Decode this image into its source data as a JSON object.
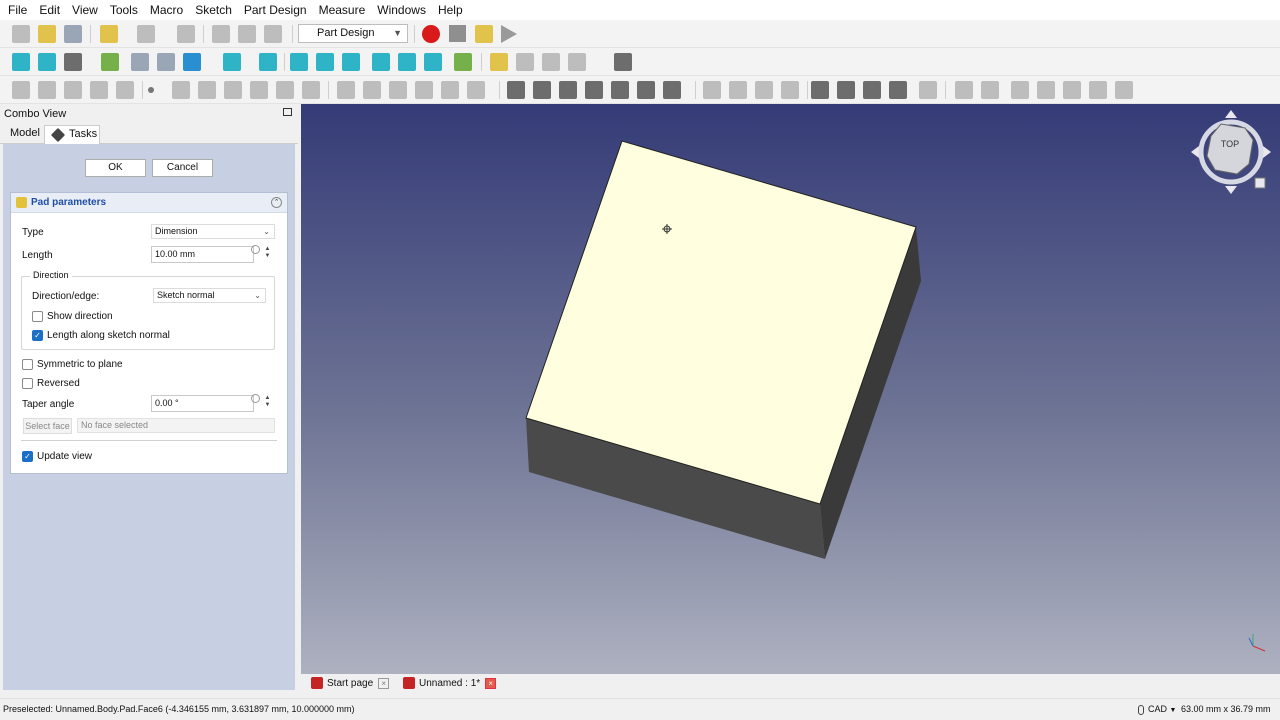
{
  "menu": [
    "File",
    "Edit",
    "View",
    "Tools",
    "Macro",
    "Sketch",
    "Part Design",
    "Measure",
    "Windows",
    "Help"
  ],
  "toolbar": {
    "workbench": "Part Design"
  },
  "combo_view": {
    "title": "Combo View",
    "tabs": [
      "Model",
      "Tasks"
    ],
    "ok_label": "OK",
    "cancel_label": "Cancel",
    "pad": {
      "title": "Pad parameters",
      "type_label": "Type",
      "type_value": "Dimension",
      "length_label": "Length",
      "length_value": "10.00 mm",
      "direction_group": "Direction",
      "direction_label": "Direction/edge:",
      "direction_value": "Sketch normal",
      "show_direction": "Show direction",
      "show_direction_checked": false,
      "length_along_normal": "Length along sketch normal",
      "length_along_normal_checked": true,
      "symmetric": "Symmetric to plane",
      "symmetric_checked": false,
      "reversed": "Reversed",
      "reversed_checked": false,
      "taper_label": "Taper angle",
      "taper_value": "0.00 °",
      "select_face": "Select face",
      "no_face": "No face selected",
      "update_view": "Update view",
      "update_view_checked": true
    }
  },
  "viewport": {
    "navcube_label": "TOP",
    "colors": {
      "top_face": "#ffffe0",
      "side_face": "#3f3f3f",
      "bottom_face": "#4a4a4a"
    }
  },
  "doc_tabs": [
    "Start page",
    "Unnamed : 1*"
  ],
  "status": {
    "message": "Preselected: Unnamed.Body.Pad.Face6 (-4.346155 mm, 3.631897 mm, 10.000000 mm)",
    "nav_style": "CAD",
    "dimensions": "63.00 mm x 36.79 mm"
  }
}
